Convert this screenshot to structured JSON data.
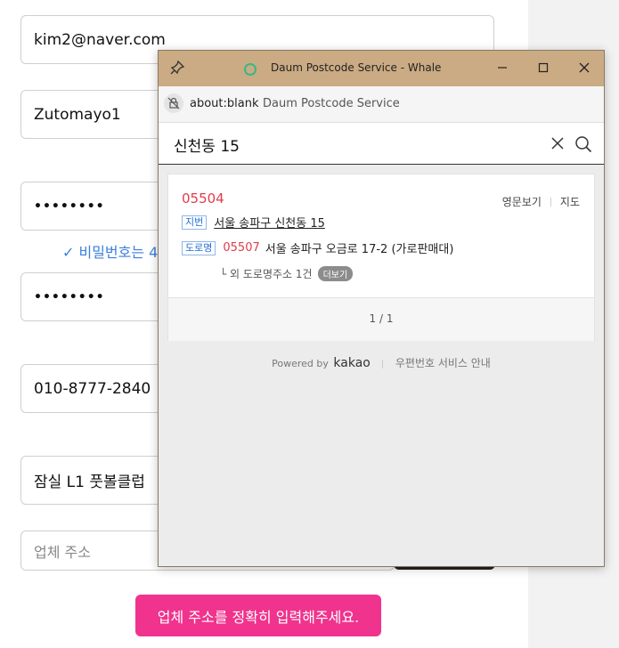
{
  "form": {
    "email": "kim2@naver.com",
    "nickname": "Zutomayo1",
    "password": "••••••••",
    "password_hint": "✓ 비밀번호는 4",
    "password_confirm": "••••••••",
    "phone": "010-8777-2840",
    "company_name": "잠실 L1 풋볼클럽",
    "company_address_placeholder": "업체 주소",
    "submit_label": "업체 주소를 정확히 입력해주세요."
  },
  "popup": {
    "window_title": "Daum Postcode Service - Whale",
    "address_url": "about:blank",
    "address_page_title": "Daum Postcode Service",
    "search_query": "신천동 15",
    "result": {
      "zipcode": "05504",
      "link_english": "영문보기",
      "link_map": "지도",
      "jibun_label": "지번",
      "jibun_address": "서울 송파구 신천동 15",
      "road_label": "도로명",
      "road_zipcode": "05507",
      "road_address": "서울 송파구 오금로 17-2 (가로판매대)",
      "other_prefix": "└ 외 도로명주소 1건",
      "more_label": "더보기"
    },
    "pager": "1 / 1",
    "footer": {
      "powered_by": "Powered by",
      "brand": "kakao",
      "guide": "우편번호 서비스 안내"
    }
  },
  "colors": {
    "title_bar": "#cbab83",
    "accent_pink": "#f0338d",
    "zip_red": "#e03c4a",
    "hint_blue": "#3b7fe0"
  }
}
